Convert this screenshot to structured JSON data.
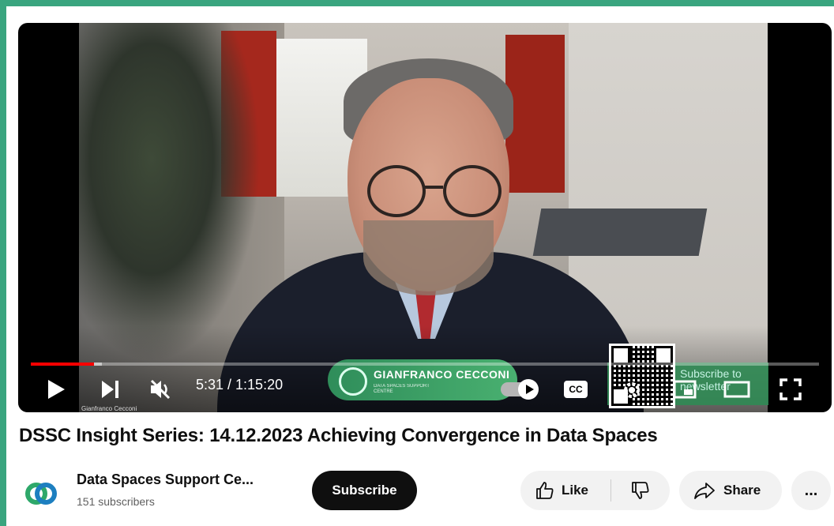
{
  "player": {
    "time_display": "5:31 / 1:15:20",
    "progress_fraction": 0.08,
    "loaded_fraction": 0.09,
    "watermark_name": "Gianfranco Cecconi",
    "overlay_name": "GIANFRANCO CECCONI",
    "overlay_org": "DATA SPACES SUPPORT CENTRE",
    "newsletter_text": "Subscribe to newsletter",
    "cc_label": "CC",
    "accent_color": "#ff0000"
  },
  "video": {
    "title": "DSSC Insight Series: 14.12.2023 Achieving Convergence in Data Spaces"
  },
  "channel": {
    "name": "Data Spaces Support Ce...",
    "subscribers": "151 subscribers",
    "subscribe_label": "Subscribe"
  },
  "actions": {
    "like_label": "Like",
    "share_label": "Share",
    "more_label": "..."
  }
}
